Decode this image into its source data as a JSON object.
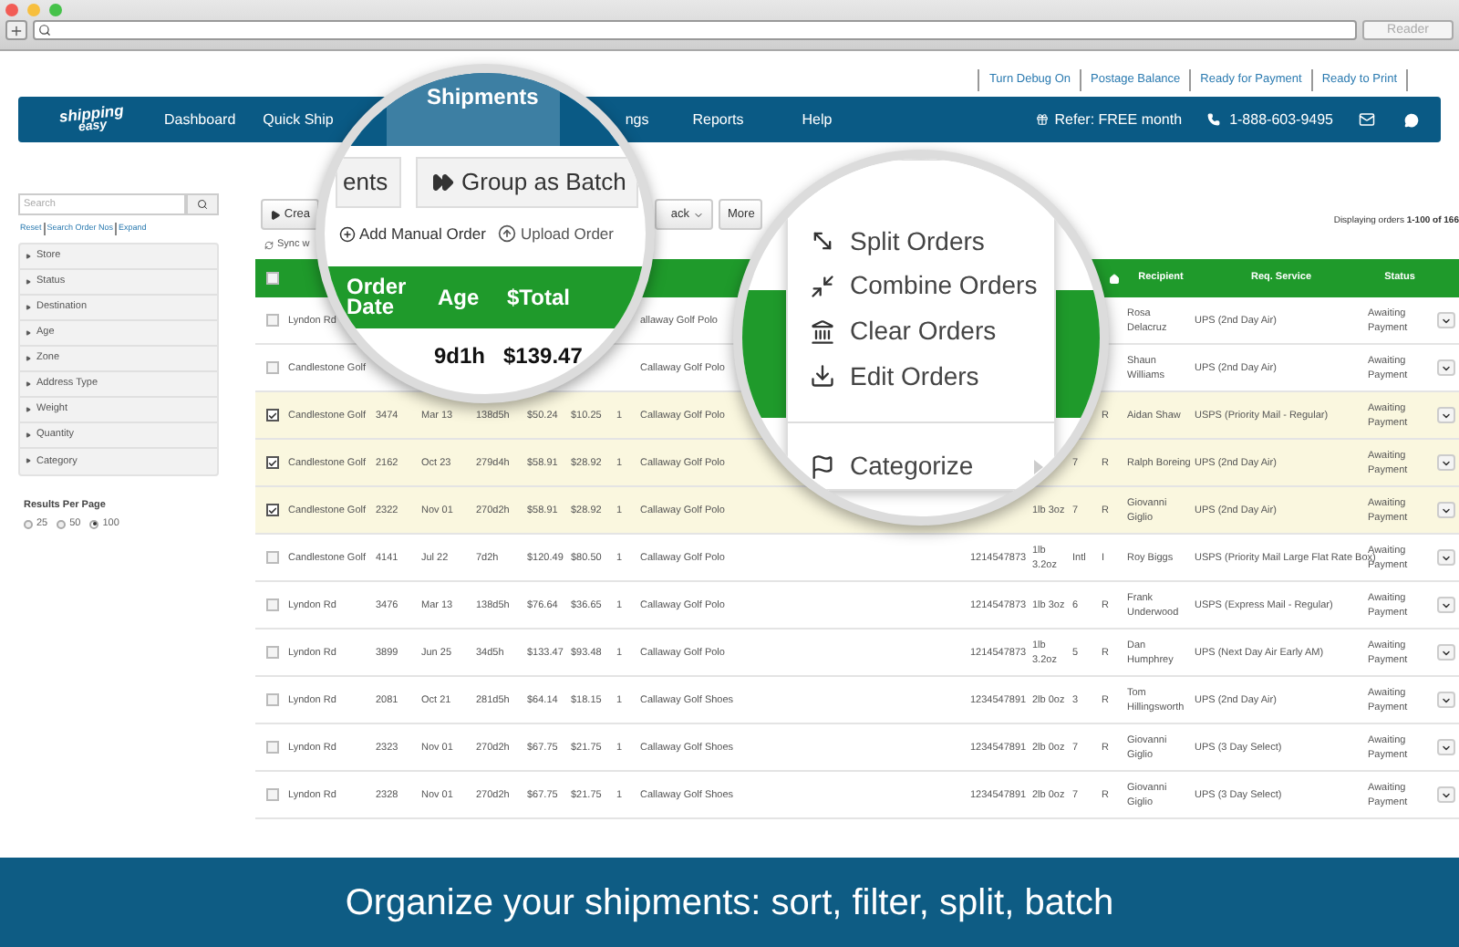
{
  "browser": {
    "reader_button": "Reader"
  },
  "top_links": [
    "Turn Debug On",
    "Postage Balance",
    "Ready for Payment",
    "Ready to Print"
  ],
  "nav": {
    "logo_top": "shipping",
    "logo_bottom": "easy",
    "items_left": [
      "Dashboard",
      "Quick Ship"
    ],
    "items_right": [
      "ngs",
      "Reports",
      "Help"
    ],
    "refer": "Refer: FREE month",
    "phone": "1-888-603-9495"
  },
  "sidebar": {
    "search_placeholder": "Search",
    "links": [
      "Reset",
      "Search Order Nos",
      "Expand"
    ],
    "filters": [
      "Store",
      "Status",
      "Destination",
      "Age",
      "Zone",
      "Address Type",
      "Weight",
      "Quantity",
      "Category"
    ],
    "results_label": "Results Per Page",
    "results_options": [
      {
        "label": "25",
        "selected": false
      },
      {
        "label": "50",
        "selected": false
      },
      {
        "label": "100",
        "selected": true
      }
    ]
  },
  "toolbar": {
    "buttons": [
      {
        "label": "Crea",
        "kind": "play"
      },
      {
        "label": "ack",
        "kind": "dropdown"
      },
      {
        "label": "More",
        "kind": "plain"
      }
    ],
    "sync": "Sync w",
    "displaying": "Displaying orders **1-100 of 166**"
  },
  "table": {
    "all_checked": false,
    "columns": [
      "Recipient",
      "Req. Service",
      "Status"
    ],
    "rows": [
      {
        "checked": false,
        "store": "Lyndon Rd",
        "item": "allaway Golf Polo",
        "recipient": "Rosa Delacruz",
        "service": "UPS (2nd Day Air)",
        "status": "Awaiting Payment"
      },
      {
        "checked": false,
        "store": "Candlestone Golf",
        "item": "Callaway Golf Polo",
        "recipient": "Shaun Williams",
        "service": "UPS (2nd Day Air)",
        "status": "Awaiting Payment"
      },
      {
        "checked": true,
        "store": "Candlestone Golf",
        "order": "3474",
        "date": "Mar 13",
        "age": "138d5h",
        "total": "$50.24",
        "shipping": "$10.25",
        "qty": "1",
        "item": "Callaway Golf Polo",
        "res": "R",
        "recipient": "Aidan Shaw",
        "service": "USPS (Priority Mail - Regular)",
        "status": "Awaiting Payment"
      },
      {
        "checked": true,
        "store": "Candlestone Golf",
        "order": "2162",
        "date": "Oct 23",
        "age": "279d4h",
        "total": "$58.91",
        "shipping": "$28.92",
        "qty": "1",
        "item": "Callaway Golf Polo",
        "zone": "7",
        "res": "R",
        "recipient": "Ralph Boreing",
        "service": "UPS (2nd Day Air)",
        "status": "Awaiting Payment"
      },
      {
        "checked": true,
        "store": "Candlestone Golf",
        "order": "2322",
        "date": "Nov 01",
        "age": "270d2h",
        "total": "$58.91",
        "shipping": "$28.92",
        "qty": "1",
        "item": "Callaway Golf Polo",
        "weight": "1lb 3oz",
        "zone": "7",
        "res": "R",
        "recipient": "Giovanni Giglio",
        "service": "UPS (2nd Day Air)",
        "status": "Awaiting Payment"
      },
      {
        "checked": false,
        "store": "Candlestone Golf",
        "order": "4141",
        "date": "Jul 22",
        "age": "7d2h",
        "total": "$120.49",
        "shipping": "$80.50",
        "qty": "1",
        "item": "Callaway Golf Polo",
        "tracking": "1214547873",
        "weight": "1lb 3.2oz",
        "zone": "Intl",
        "res": "I",
        "recipient": "Roy Biggs",
        "service": "USPS (Priority Mail Large Flat Rate Box)",
        "status": "Awaiting Payment"
      },
      {
        "checked": false,
        "store": "Lyndon Rd",
        "order": "3476",
        "date": "Mar 13",
        "age": "138d5h",
        "total": "$76.64",
        "shipping": "$36.65",
        "qty": "1",
        "item": "Callaway Golf Polo",
        "tracking": "1214547873",
        "weight": "1lb 3oz",
        "zone": "6",
        "res": "R",
        "recipient": "Frank Underwood",
        "service": "USPS (Express Mail - Regular)",
        "status": "Awaiting Payment"
      },
      {
        "checked": false,
        "store": "Lyndon Rd",
        "order": "3899",
        "date": "Jun 25",
        "age": "34d5h",
        "total": "$133.47",
        "shipping": "$93.48",
        "qty": "1",
        "item": "Callaway Golf Polo",
        "tracking": "1214547873",
        "weight": "1lb 3.2oz",
        "zone": "5",
        "res": "R",
        "recipient": "Dan Humphrey",
        "service": "UPS (Next Day Air Early AM)",
        "status": "Awaiting Payment"
      },
      {
        "checked": false,
        "store": "Lyndon Rd",
        "order": "2081",
        "date": "Oct 21",
        "age": "281d5h",
        "total": "$64.14",
        "shipping": "$18.15",
        "qty": "1",
        "item": "Callaway Golf Shoes",
        "tracking": "1234547891",
        "weight": "2lb 0oz",
        "zone": "3",
        "res": "R",
        "recipient": "Tom Hillingsworth",
        "service": "UPS (2nd Day Air)",
        "status": "Awaiting Payment"
      },
      {
        "checked": false,
        "store": "Lyndon Rd",
        "order": "2323",
        "date": "Nov 01",
        "age": "270d2h",
        "total": "$67.75",
        "shipping": "$21.75",
        "qty": "1",
        "item": "Callaway Golf Shoes",
        "tracking": "1234547891",
        "weight": "2lb 0oz",
        "zone": "7",
        "res": "R",
        "recipient": "Giovanni Giglio",
        "service": "UPS (3 Day Select)",
        "status": "Awaiting Payment"
      },
      {
        "checked": false,
        "store": "Lyndon Rd",
        "order": "2328",
        "date": "Nov 01",
        "age": "270d2h",
        "total": "$67.75",
        "shipping": "$21.75",
        "qty": "1",
        "item": "Callaway Golf Shoes",
        "tracking": "1234547891",
        "weight": "2lb 0oz",
        "zone": "7",
        "res": "R",
        "recipient": "Giovanni Giglio",
        "service": "UPS (3 Day Select)",
        "status": "Awaiting Payment"
      }
    ]
  },
  "magnifier_left": {
    "nav_tab": "Shipments",
    "tabs": [
      "ents",
      "Group as Batch"
    ],
    "actions": [
      "Add Manual Order",
      "Upload Order"
    ],
    "columns": [
      "Order Date",
      "Age",
      "$Total"
    ],
    "row": [
      "9d1h",
      "$139.47"
    ]
  },
  "magnifier_right": {
    "menu": [
      {
        "label": "Split Orders",
        "kind": "split"
      },
      {
        "label": "Combine Orders",
        "kind": "combine"
      },
      {
        "label": "Clear Orders",
        "kind": "clear"
      },
      {
        "label": "Edit Orders",
        "kind": "edit"
      },
      {
        "label": "Categorize",
        "kind": "flag",
        "submenu": true
      }
    ]
  },
  "banner": "Organize your shipments: sort, filter, split, batch"
}
